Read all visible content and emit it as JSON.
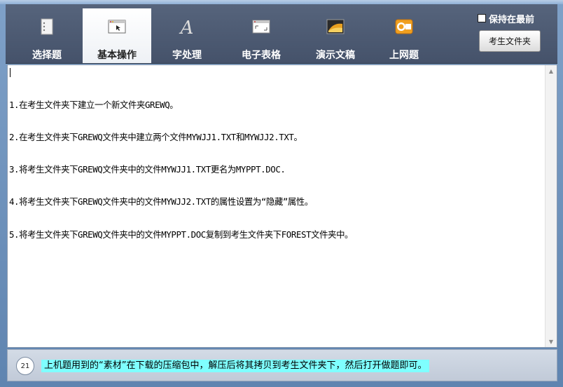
{
  "toolbar": {
    "tabs": [
      {
        "label": "选择题",
        "icon": "document-list-icon"
      },
      {
        "label": "基本操作",
        "icon": "window-cursor-icon",
        "active": true
      },
      {
        "label": "字处理",
        "icon": "letter-a-icon"
      },
      {
        "label": "电子表格",
        "icon": "spreadsheet-window-icon"
      },
      {
        "label": "演示文稿",
        "icon": "presentation-icon"
      },
      {
        "label": "上网题",
        "icon": "outlook-icon"
      }
    ],
    "keep_front_label": "保持在最前",
    "folder_button_label": "考生文件夹"
  },
  "content": {
    "lines": [
      "1.在考生文件夹下建立一个新文件夹GREWQ。",
      "2.在考生文件夹下GREWQ文件夹中建立两个文件MYWJJ1.TXT和MYWJJ2.TXT。",
      "3.将考生文件夹下GREWQ文件夹中的文件MYWJJ1.TXT更名为MYPPT.DOC.",
      "4.将考生文件夹下GREWQ文件夹中的文件MYWJJ2.TXT的属性设置为“隐藏”属性。",
      "5.将考生文件夹下GREWQ文件夹中的文件MYPPT.DOC复制到考生文件夹下FOREST文件夹中。"
    ]
  },
  "footer": {
    "badge": "21",
    "message": "上机题用到的“素材”在下载的压缩包中，解压后将其拷贝到考生文件夹下，然后打开做题即可。"
  },
  "colors": {
    "toolbar_bg": "#4d5a72",
    "highlight": "#7fffff",
    "window_bg": "#6a8cb4"
  }
}
